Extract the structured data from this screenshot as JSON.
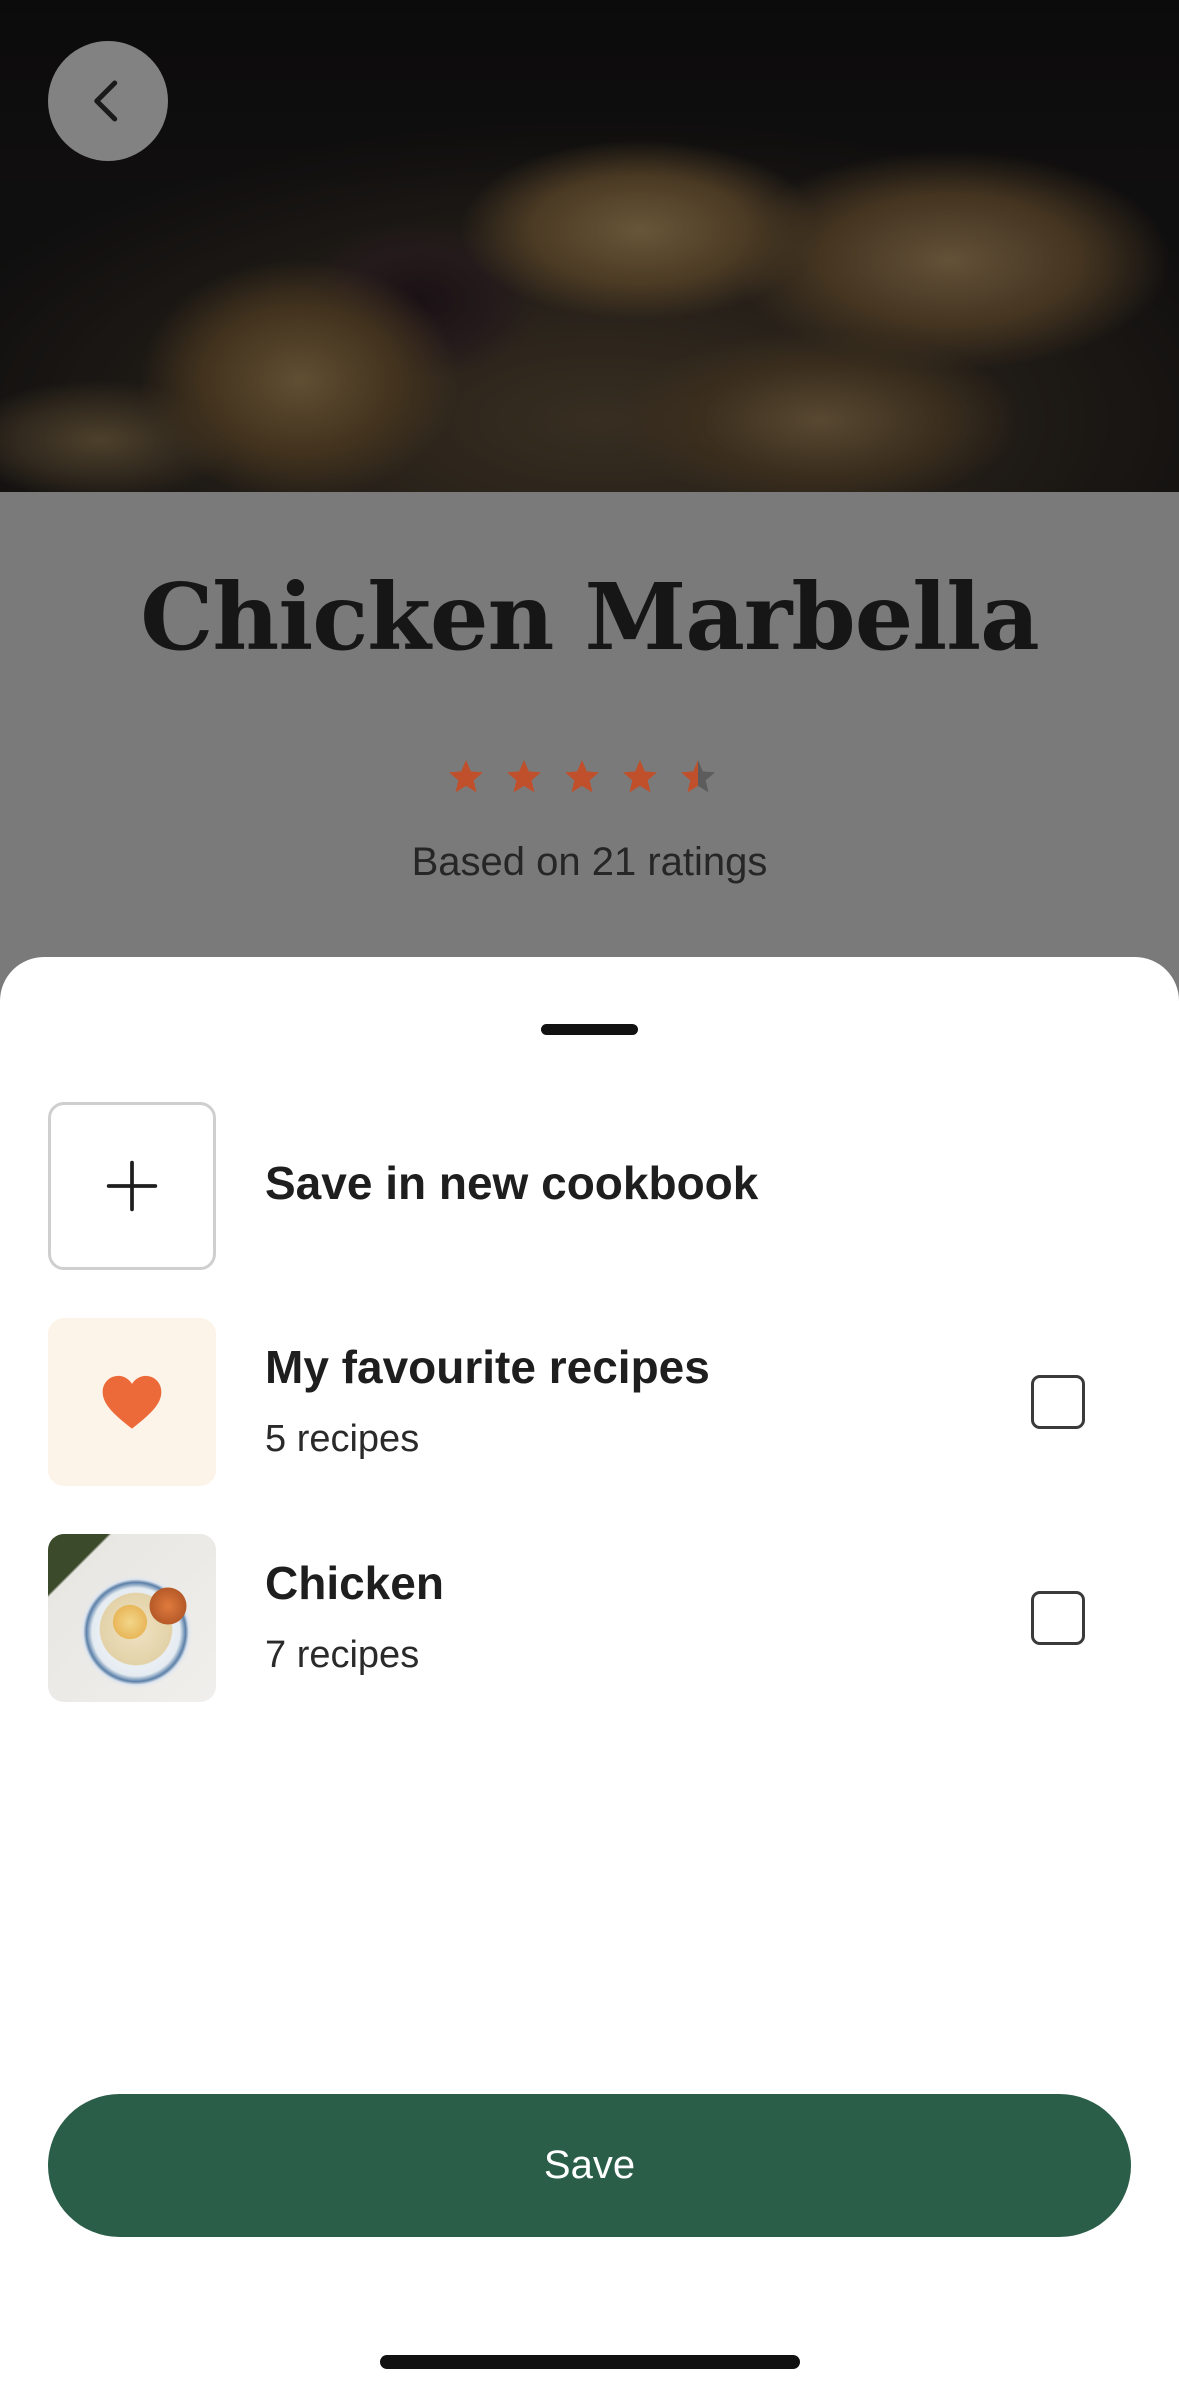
{
  "recipe": {
    "title": "Chicken Marbella",
    "rating": 4.5,
    "rating_max": 5,
    "rating_text": "Based on 21 ratings"
  },
  "colors": {
    "star": "#c0502b",
    "star_empty": "#5c5c5c",
    "heart": "#ec6a3a",
    "save_button": "#2b5e49"
  },
  "sheet": {
    "new_cookbook": {
      "label": "Save in new cookbook",
      "icon": "plus-icon"
    },
    "cookbooks": [
      {
        "title": "My favourite recipes",
        "count": "5 recipes",
        "icon": "heart-icon",
        "checked": false
      },
      {
        "title": "Chicken",
        "count": "7 recipes",
        "icon": "cookbook-photo",
        "checked": false
      }
    ],
    "save_label": "Save"
  }
}
